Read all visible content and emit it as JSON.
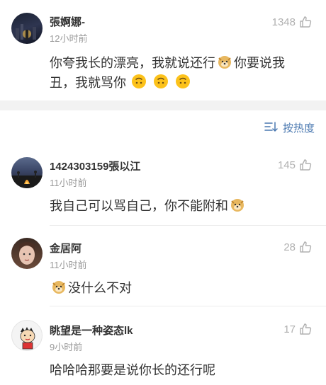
{
  "top_comment": {
    "username": "張婀娜-",
    "time": "12小时前",
    "likes": "1348",
    "line1_a": "你夸我长的漂亮，我就说还行",
    "line1_b": "你要说我",
    "line2": "丑，我就骂你"
  },
  "sort": {
    "label": "按热度"
  },
  "comments": [
    {
      "username": "1424303159張以江",
      "time": "11小时前",
      "likes": "145",
      "text": "我自己可以骂自己，你不能附和"
    },
    {
      "username": "金居阿",
      "time": "11小时前",
      "likes": "28",
      "text": "没什么不对"
    },
    {
      "username": "眺望是一种姿态lk",
      "time": "9小时前",
      "likes": "17",
      "text": "哈哈哈那要是说你长的还行呢"
    }
  ],
  "icons": {
    "like": "thumbs-up-icon",
    "sort": "sort-lines-icon",
    "doge": "doge-emoji",
    "upside_down": "upside-down-face-emoji"
  },
  "colors": {
    "accent": "#4a78b0",
    "muted": "#9a9a9a",
    "band": "#f2f2f2"
  }
}
